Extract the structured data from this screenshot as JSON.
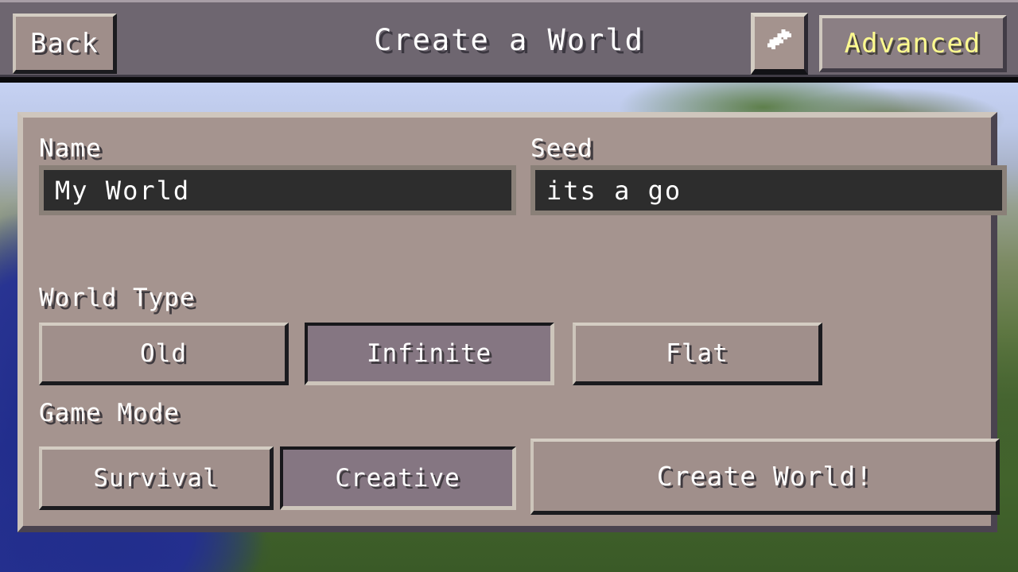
{
  "header": {
    "back_label": "Back",
    "title": "Create a World",
    "swap_icon": "diagonal-double-arrow-icon",
    "advanced_label": "Advanced",
    "advanced_color": "#fdfa8f",
    "bar_color": "#6e6670"
  },
  "panel": {
    "background_color": "#a5948f",
    "name": {
      "label": "Name",
      "value": "My World",
      "placeholder": "My World"
    },
    "seed": {
      "label": "Seed",
      "value": "its a go",
      "placeholder": "Seed"
    },
    "world_type": {
      "label": "World Type",
      "selected": "Infinite",
      "options": [
        {
          "label": "Old",
          "selected": false
        },
        {
          "label": "Infinite",
          "selected": true
        },
        {
          "label": "Flat",
          "selected": false
        }
      ]
    },
    "game_mode": {
      "label": "Game Mode",
      "selected": "Creative",
      "options": [
        {
          "label": "Survival",
          "selected": false
        },
        {
          "label": "Creative",
          "selected": true
        }
      ]
    },
    "create_world_label": "Create World!"
  },
  "colors": {
    "selected_button": "#857682",
    "unselected_button": "#a08f8b",
    "input_background": "#2d2d2d",
    "text": "#ffffff",
    "text_shadow": "#413c40"
  }
}
